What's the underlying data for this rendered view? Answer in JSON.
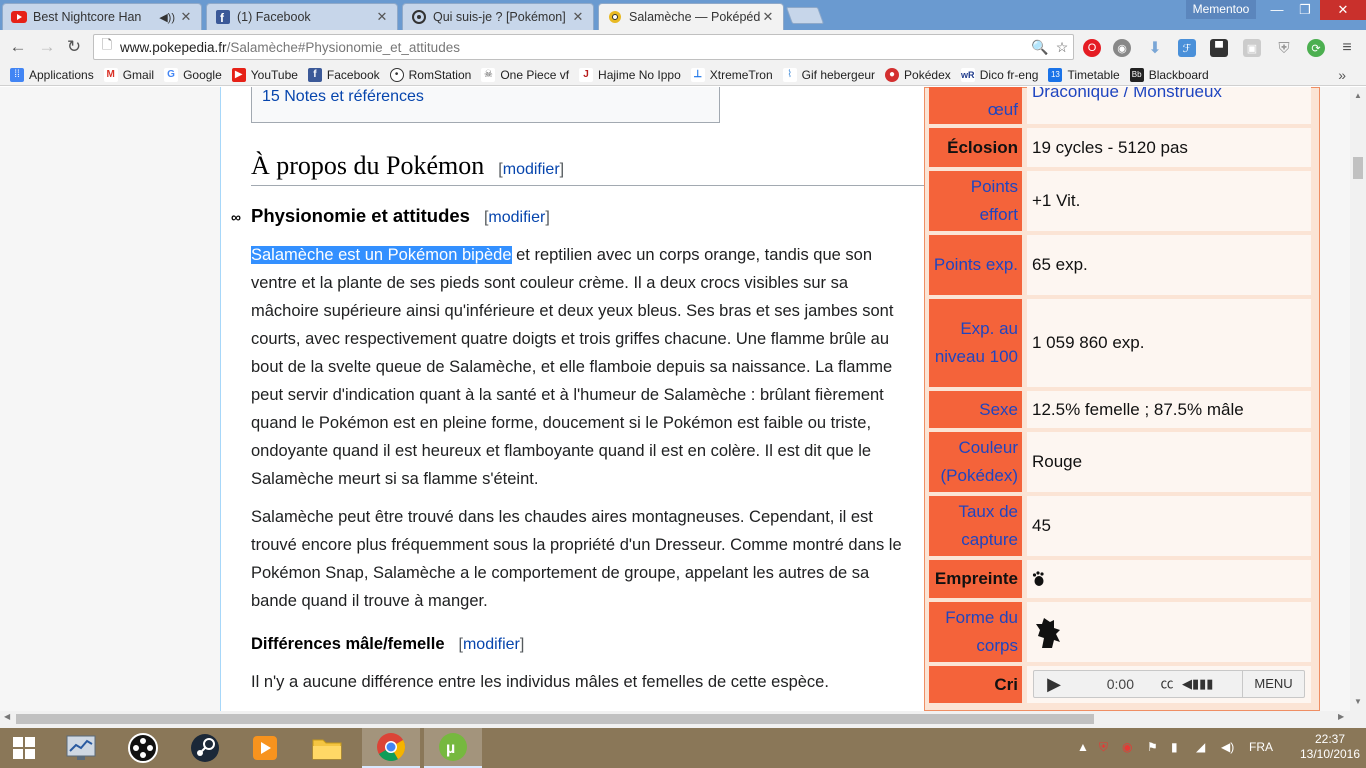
{
  "browser": {
    "tabs": [
      {
        "title": "Best Nightcore Han",
        "favicon": "youtube-icon",
        "color": "#e62117"
      },
      {
        "title": "(1) Facebook",
        "favicon": "facebook-icon",
        "color": "#3b5998"
      },
      {
        "title": "Qui suis-je ? [Pokémon]",
        "favicon": "romstation-icon",
        "color": "#333333"
      },
      {
        "title": "Salamèche — Poképédia",
        "favicon": "pokepedia-icon",
        "color": "#e8b923"
      }
    ],
    "profile_name": "Mementoo",
    "address": {
      "host": "www.pokepedia.fr",
      "path": "/Salamèche#Physionomie_et_attitudes"
    }
  },
  "bookmarks": [
    {
      "label": "Applications",
      "icon": "apps-grid-icon",
      "color": "#4285f4"
    },
    {
      "label": "Gmail",
      "icon": "gmail-icon",
      "color": "#d93025"
    },
    {
      "label": "Google",
      "icon": "google-icon",
      "color": "#4285f4"
    },
    {
      "label": "YouTube",
      "icon": "youtube-icon",
      "color": "#e62117"
    },
    {
      "label": "Facebook",
      "icon": "facebook-icon",
      "color": "#3b5998"
    },
    {
      "label": "RomStation",
      "icon": "romstation-icon",
      "color": "#333333"
    },
    {
      "label": "One Piece vf",
      "icon": "onepiece-icon",
      "color": "#555555"
    },
    {
      "label": "Hajime No Ippo",
      "icon": "ippo-icon",
      "color": "#222222"
    },
    {
      "label": "XtremeTron",
      "icon": "xtremetron-icon",
      "color": "#1a73e8"
    },
    {
      "label": "Gif hebergeur",
      "icon": "gif-icon",
      "color": "#4a90d9"
    },
    {
      "label": "Pokédex",
      "icon": "pokeball-icon",
      "color": "#d32f2f"
    },
    {
      "label": "Dico fr-eng",
      "icon": "wordreference-icon",
      "color": "#1e3a8a"
    },
    {
      "label": "Timetable",
      "icon": "calendar-icon",
      "color": "#1a73e8"
    },
    {
      "label": "Blackboard",
      "icon": "blackboard-icon",
      "color": "#222222"
    }
  ],
  "article": {
    "toc_tail": "15 Notes et références",
    "edit_label": "modifier",
    "section_title": "À propos du Pokémon",
    "subsection_title": "Physionomie et attitudes",
    "para1_highlight": "Salamèche est un Pokémon bipède",
    "para1_rest": " et reptilien avec un corps orange, tandis que son ventre et la plante de ses pieds sont couleur crème. Il a deux crocs visibles sur sa mâchoire supérieure ainsi qu'inférieure et deux yeux bleus. Ses bras et ses jambes sont courts, avec respectivement quatre doigts et trois griffes chacune. Une flamme brûle au bout de la svelte queue de Salamèche, et elle flamboie depuis sa naissance. La flamme peut servir d'indication quant à la santé et à l'humeur de Salamèche : brûlant fièrement quand le Pokémon est en pleine forme, doucement si le Pokémon est faible ou triste, ondoyante quand il est heureux et flamboyante quand il est en colère. Il est dit que le Salamèche meurt si sa flamme s'éteint.",
    "para2": "Salamèche peut être trouvé dans les chaudes aires montagneuses. Cependant, il est trouvé encore plus fréquemment sous la propriété d'un Dresseur. Comme montré dans le Pokémon Snap, Salamèche a le comportement de groupe, appelant les autres de sa bande quand il trouve à manger.",
    "subsection2_title": "Différences mâle/femelle",
    "para3": "Il n'y a aucune différence entre les individus mâles et femelles de cette espèce."
  },
  "infobox": {
    "rows": [
      {
        "label": "œuf",
        "value": "Draconique / Monstrueux"
      },
      {
        "label": "Éclosion",
        "value": "19 cycles - 5120 pas"
      },
      {
        "label": "Points effort",
        "value": "+1 Vit."
      },
      {
        "label": "Points exp.",
        "value": "65 exp."
      },
      {
        "label": "Exp. au niveau 100",
        "value": "1 059 860 exp."
      },
      {
        "label": "Sexe",
        "value": "12.5% femelle ; 87.5% mâle"
      },
      {
        "label": "Couleur (Pokédex)",
        "value": "Rouge"
      },
      {
        "label": "Taux de capture",
        "value": "45"
      },
      {
        "label": "Empreinte",
        "value": ""
      },
      {
        "label": "Forme du corps",
        "value": ""
      },
      {
        "label": "Cri",
        "value": ""
      }
    ],
    "audio": {
      "time": "0:00",
      "menu": "MENU"
    }
  },
  "taskbar": {
    "lang": "FRA",
    "time": "22:37",
    "date": "13/10/2016"
  }
}
